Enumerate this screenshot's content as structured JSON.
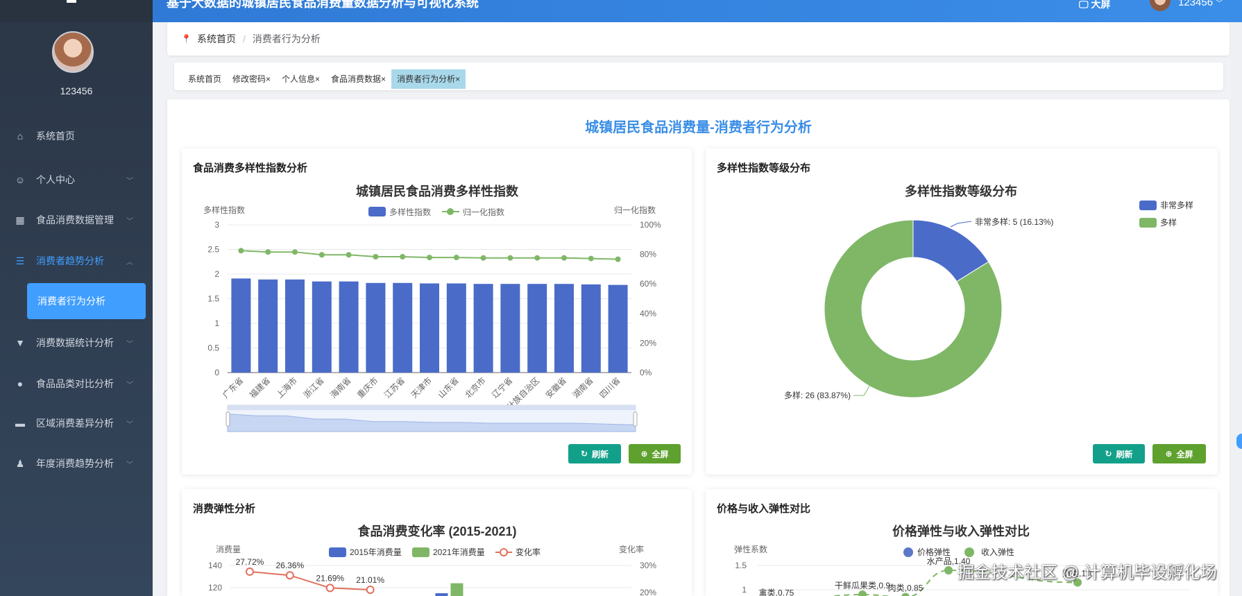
{
  "header": {
    "title": "基于大数据的城镇居民食品消费量数据分析与可视化系统",
    "screen_label": "大屏",
    "username": "123456"
  },
  "sidebar": {
    "username": "123456",
    "items": [
      {
        "label": "系统首页",
        "icon": "home-icon"
      },
      {
        "label": "个人中心",
        "icon": "user-icon"
      },
      {
        "label": "食品消费数据管理",
        "icon": "grid-icon"
      },
      {
        "label": "消费者趋势分析",
        "icon": "list-icon",
        "open": true
      },
      {
        "label": "消费数据统计分析",
        "icon": "brush-icon"
      },
      {
        "label": "食品品类对比分析",
        "icon": "bulb-icon"
      },
      {
        "label": "区域消费差异分析",
        "icon": "monitor-icon"
      },
      {
        "label": "年度消费趋势分析",
        "icon": "stamp-icon"
      }
    ],
    "sub_item": "消费者行为分析"
  },
  "breadcrumb": {
    "home": "系统首页",
    "sep": "/",
    "current": "消费者行为分析"
  },
  "tabs": [
    "系统首页",
    "修改密码×",
    "个人信息×",
    "食品消费数据×",
    "消费者行为分析×"
  ],
  "main": {
    "title": "城镇居民食品消费量-消费者行为分析",
    "panels": [
      {
        "title": "食品消费多样性指数分析"
      },
      {
        "title": "多样性指数等级分布"
      },
      {
        "title": "消费弹性分析"
      },
      {
        "title": "价格与收入弹性对比"
      }
    ],
    "refresh": "刷新",
    "fullscreen": "全屏"
  },
  "watermark": "掘金技术社区 @ 计算机毕设孵化场",
  "colors": {
    "blue": "#4a6bc8",
    "green": "#7fb767",
    "red": "#e0705c",
    "accent": "#409eff"
  },
  "chart_data": [
    {
      "type": "bar",
      "title": "城镇居民食品消费多样性指数",
      "ylabel": "多样性指数",
      "y2label": "归一化指数",
      "categories": [
        "广东省",
        "福建省",
        "上海市",
        "浙江省",
        "海南省",
        "重庆市",
        "江苏省",
        "天津市",
        "山东省",
        "北京市",
        "辽宁省",
        "广西壮族自治区",
        "安徽省",
        "湖南省",
        "四川省"
      ],
      "series": [
        {
          "name": "多样性指数",
          "type": "bar",
          "values": [
            1.91,
            1.89,
            1.89,
            1.85,
            1.85,
            1.82,
            1.82,
            1.81,
            1.81,
            1.8,
            1.8,
            1.8,
            1.8,
            1.79,
            1.78
          ]
        },
        {
          "name": "归一化指数",
          "type": "line",
          "values": [
            82.5,
            81.6,
            81.6,
            79.7,
            79.7,
            78.4,
            78.4,
            77.9,
            77.9,
            77.6,
            77.6,
            77.6,
            77.6,
            77.2,
            76.7
          ]
        }
      ],
      "ylim": [
        0,
        3
      ],
      "yticks": [
        "0",
        "0.5",
        "1",
        "1.5",
        "2",
        "2.5",
        "3"
      ],
      "y2ticks": [
        "0%",
        "20%",
        "40%",
        "60%",
        "80%",
        "100%"
      ]
    },
    {
      "type": "pie",
      "title": "多样性指数等级分布",
      "slices": [
        {
          "name": "非常多样",
          "value": 5,
          "label": "非常多样: 5 (16.13%)"
        },
        {
          "name": "多样",
          "value": 26,
          "label": "多样: 26 (83.87%)"
        }
      ]
    },
    {
      "type": "bar",
      "title": "食品消费变化率 (2015-2021)",
      "ylabel": "消费量",
      "y2label": "变化率",
      "legend": [
        "2015年消费量",
        "2021年消费量",
        "变化率"
      ],
      "yticks": [
        "140",
        "120"
      ],
      "y2ticks": [
        "30%",
        "20%"
      ],
      "rate": [
        {
          "index": 0,
          "value": 27.72,
          "label": "27.72%"
        },
        {
          "index": 1,
          "value": 26.36,
          "label": "26.36%"
        },
        {
          "index": 2,
          "value": 21.69,
          "label": "21.69%"
        },
        {
          "index": 3,
          "value": 21.01,
          "label": "21.01%"
        }
      ],
      "bars": [
        {
          "index": 5,
          "v2015": 115,
          "v2021": 124
        }
      ]
    },
    {
      "type": "line",
      "title": "价格弹性与收入弹性对比",
      "ylabel": "弹性系数",
      "legend": [
        "价格弹性",
        "收入弹性"
      ],
      "yticks": [
        "1.5",
        "1"
      ],
      "income": [
        {
          "index": 0,
          "name": "禽类",
          "value": 0.75,
          "label": "禽类,0.75"
        },
        {
          "index": 2,
          "name": "干鲜瓜果类",
          "value": 0.9,
          "label": "干鲜瓜果类,0.9"
        },
        {
          "index": 3,
          "name": "肉类",
          "value": 0.85,
          "label": "肉类,0.85"
        },
        {
          "index": 4,
          "name": "水产品",
          "value": 1.4,
          "label": "水产品,1.40"
        },
        {
          "index": 7,
          "name": "奶类",
          "value": 1.15,
          "label": "奶类,1.1"
        }
      ]
    }
  ]
}
